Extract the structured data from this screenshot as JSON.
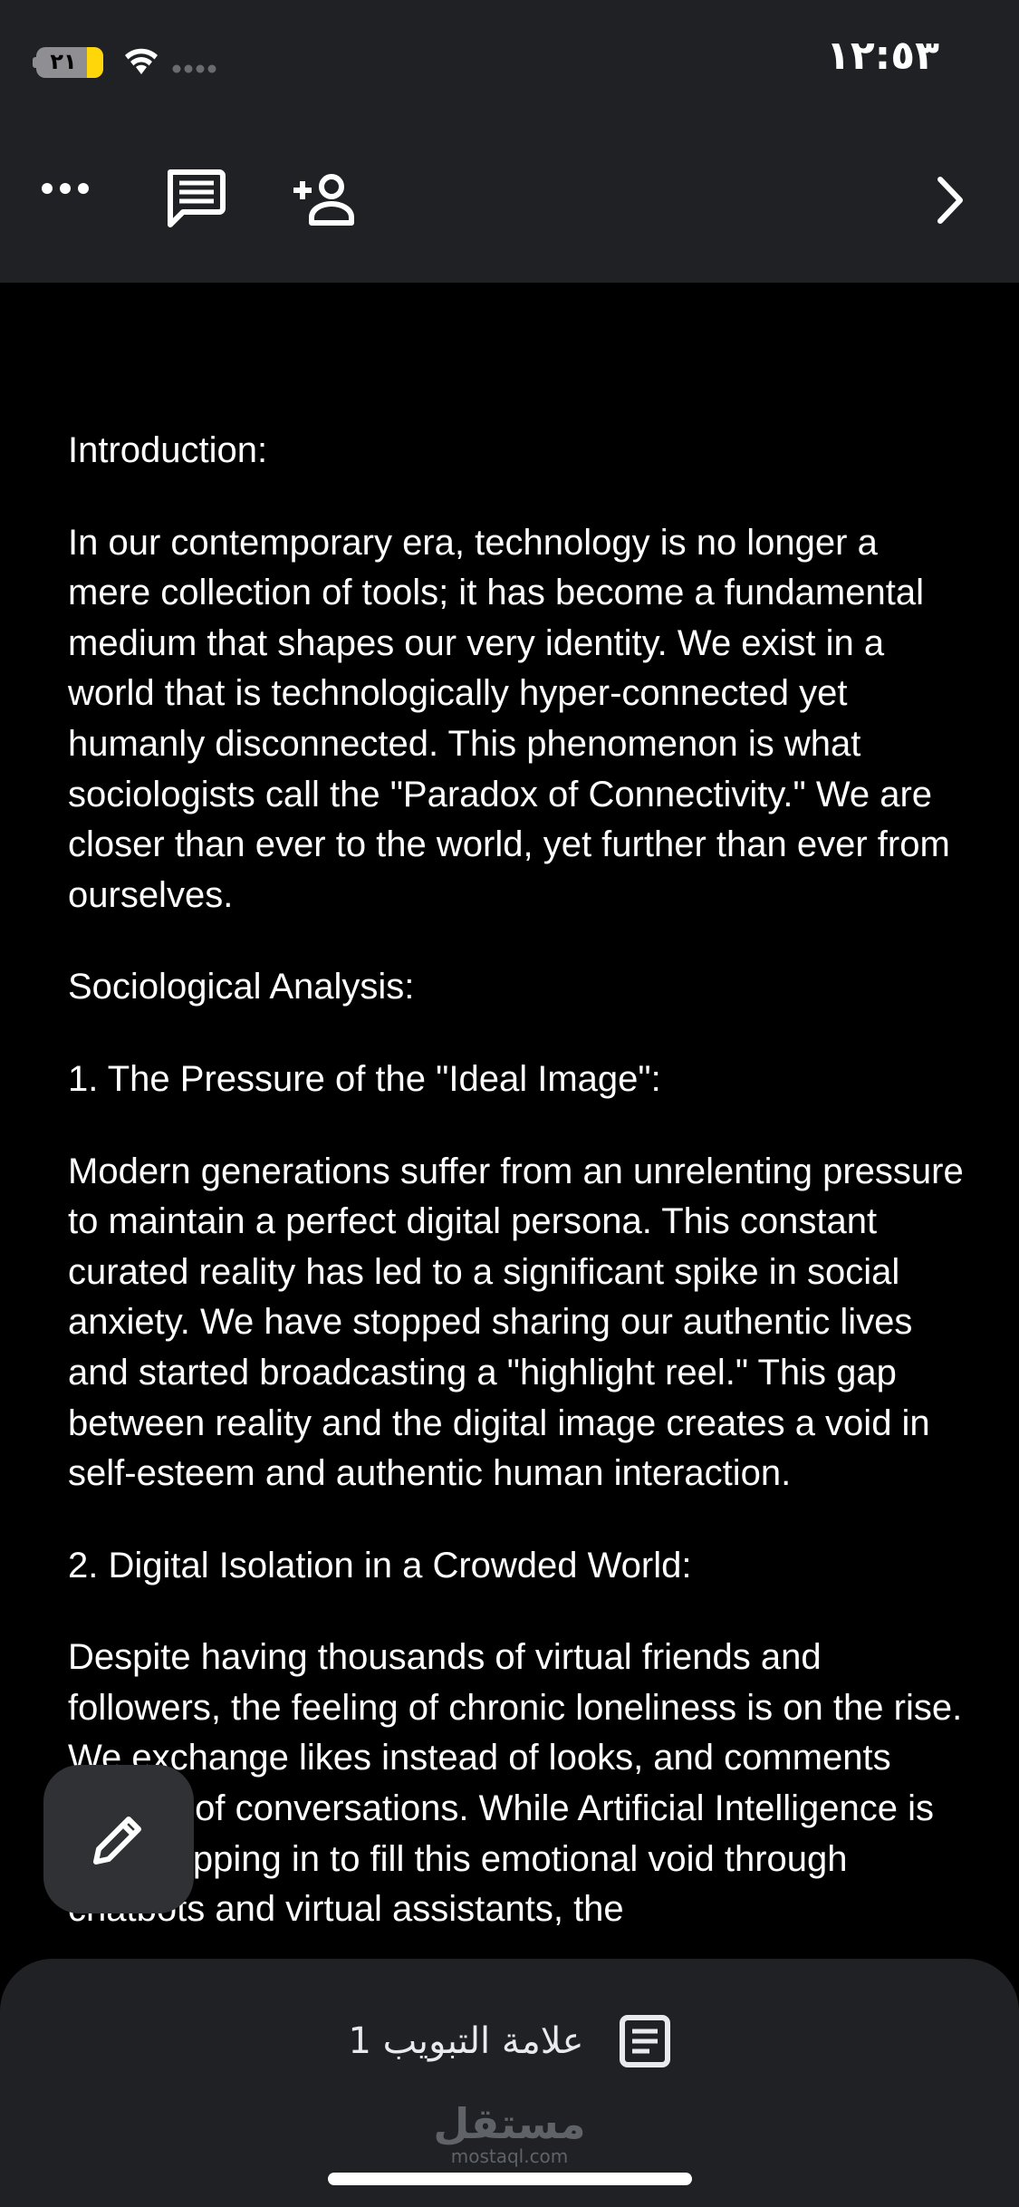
{
  "status_bar": {
    "time": "١٢:٥٣",
    "battery": "٢١"
  },
  "toolbar": {
    "icons": [
      "more-horizontal-icon",
      "comment-icon",
      "add-person-icon",
      "chevron-right-icon"
    ]
  },
  "document": {
    "paragraphs": [
      "Introduction:",
      "In our contemporary era, technology is no longer a mere collection of tools; it has become a fundamental medium that shapes our very identity. We exist in a world that is technologically hyper-connected yet humanly disconnected. This phenomenon is what sociologists call the \"Paradox of Connectivity.\" We are closer than ever to the world, yet further than ever from ourselves.",
      "Sociological Analysis:",
      "1. The Pressure of the \"Ideal Image\":",
      "Modern generations suffer from an unrelenting pressure to maintain a perfect digital persona. This constant curated reality has led to a significant spike in social anxiety. We have stopped sharing our authentic lives and started broadcasting a \"highlight reel.\" This gap between reality and the digital image creates a void in self-esteem and authentic human interaction.",
      "2. Digital Isolation in a Crowded World:",
      "Despite having thousands of virtual friends and followers, the feeling of chronic loneliness is on the rise. We exchange likes instead of looks, and comments instead of conversations. While Artificial Intelligence is now stepping in to fill this emotional void through chatbots and virtual assistants, the"
    ]
  },
  "bottom_bar": {
    "tab_label": "علامة التبويب 1",
    "watermark_ar": "مستقل",
    "watermark_en": "mostaql.com"
  },
  "colors": {
    "toolbar_bg": "#202124",
    "page_bg": "#000000",
    "fab_bg": "#303134",
    "battery_accent": "#ffd60a"
  }
}
